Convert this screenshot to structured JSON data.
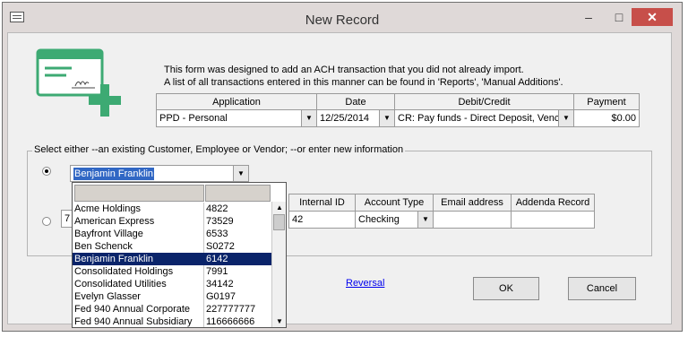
{
  "window": {
    "title": "New Record",
    "minimize_glyph": "–",
    "maximize_glyph": "□",
    "close_glyph": "✕"
  },
  "info": {
    "line1": "This form was designed to add an ACH transaction that you did not already import.",
    "line2": "A list of all transactions entered in this manner can be found in 'Reports', 'Manual Additions'."
  },
  "transaction_grid": {
    "headers": {
      "application": "Application",
      "date": "Date",
      "debit_credit": "Debit/Credit",
      "payment": "Payment"
    },
    "values": {
      "application": "PPD - Personal",
      "date": "12/25/2014",
      "debit_credit": "CR: Pay funds - Direct Deposit, Venc",
      "payment": "$0.00"
    }
  },
  "select_group": {
    "legend": "Select either --an existing Customer, Employee or Vendor;  --or enter new information",
    "existing_value": "Benjamin Franklin"
  },
  "new_info_grid": {
    "first_value": "7",
    "headers": {
      "internal_id": "Internal ID",
      "account_type": "Account Type",
      "email": "Email address",
      "addenda": "Addenda Record"
    },
    "values": {
      "internal_id": "42",
      "account_type": "Checking",
      "email": "",
      "addenda": ""
    }
  },
  "dropdown": {
    "rows": [
      {
        "name": "Acme Holdings",
        "id": "4822"
      },
      {
        "name": "American Express",
        "id": "73529"
      },
      {
        "name": "Bayfront Village",
        "id": "6533"
      },
      {
        "name": "Ben Schenck",
        "id": "S0272"
      },
      {
        "name": "Benjamin Franklin",
        "id": "6142"
      },
      {
        "name": "Consolidated Holdings",
        "id": "7991"
      },
      {
        "name": "Consolidated Utilities",
        "id": "34142"
      },
      {
        "name": "Evelyn Glasser",
        "id": "G0197"
      },
      {
        "name": "Fed 940 Annual Corporate",
        "id": "227777777"
      },
      {
        "name": "Fed 940 Annual Subsidiary",
        "id": "116666666"
      }
    ],
    "selected_index": 4
  },
  "footer": {
    "reversal_link": "Reversal",
    "ok_label": "OK",
    "cancel_label": "Cancel"
  },
  "colors": {
    "check_green": "#3daa73",
    "selection_blue": "#0a246a",
    "close_red": "#c74f4a"
  },
  "icons": {
    "check_graphic": "check-with-plus-icon",
    "combo_arrow": "chevron-down-icon"
  }
}
